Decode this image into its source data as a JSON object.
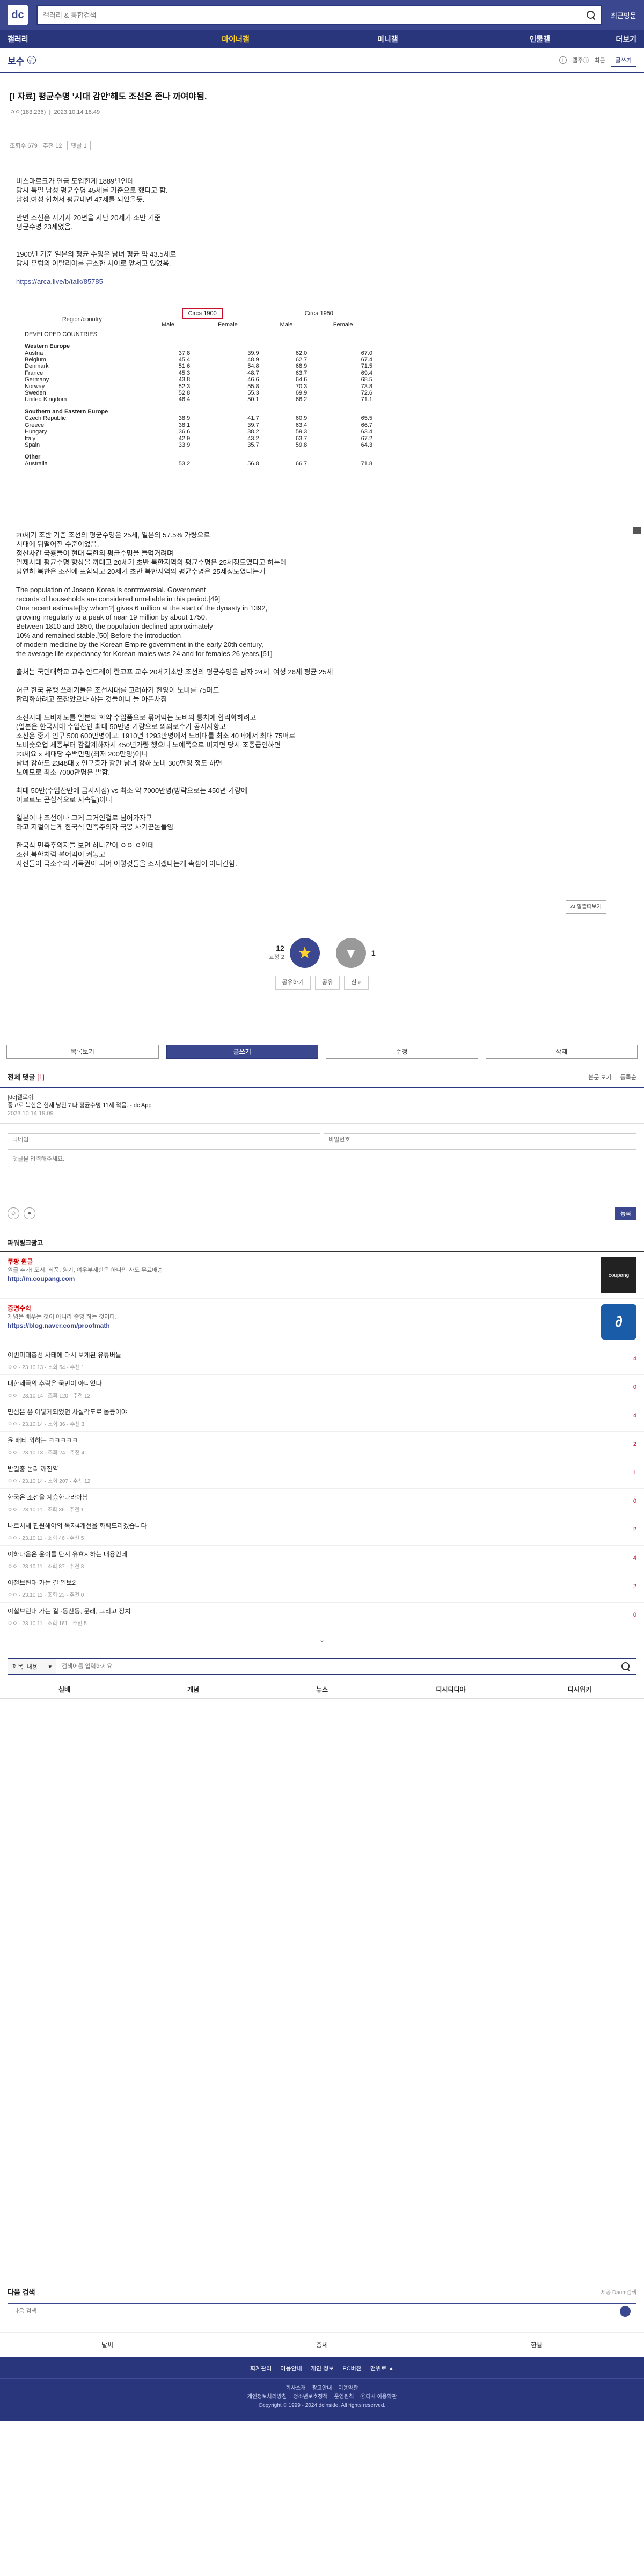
{
  "header": {
    "logo": "dc",
    "search_placeholder": "갤러리 & 통합검색",
    "recent": "최근방문",
    "nav": [
      "갤러리",
      "마이너갤",
      "미니갤",
      "인물갤",
      "더보기"
    ]
  },
  "gallery": {
    "title": "보수",
    "badge": "ⓜ",
    "info_label": "갤주ⓘ",
    "recent_btn": "최근",
    "write_btn": "글쓰기"
  },
  "post": {
    "title": "[I 자료] 평균수명 '시대 감안'해도 조선은 존나 까여야됨.",
    "author": "ㅇㅇ(183.236)",
    "date": "2023.10.14 18:49",
    "views": "조회수 679",
    "recommends": "추천 12",
    "tag": "댓글 1",
    "paragraph1": "비스마르크가 연금 도입한게 1889년인데\n당시 독일 남성 평균수명 45세를 기준으로 했다고 함.\n남성,여성 합쳐서 평균내면 47세를 되었을듯.",
    "paragraph2": "반면 조선은 지기사 20년을 지난 20세기 조반 기준\n평균수명 23세였음.",
    "paragraph3": "1900년 기준 일본의 평균 수명은 남녀 평균 약 43.5세로\n당시 유럽의 이탈리아를 근소한 차이로 앞서고 있었음.",
    "link": "https://arca.live/b/talk/85785",
    "paragraph4": "20세기 조반 기준 조선의 평균수명은 25세, 일본의 57.5% 가량으로\n시대에 뒤떨어진 수준이었음.\n정산사간 국룡들이 현대 북한의 평균수명을 들먹거려며\n일제시대 평균수명 향상을 까대고 20세기 초반 북한지역의 평균수명은 25세정도였다고 하는데\n당연히 북한은 조선에 포함되고 20세기 초반 북한지역의 평균수명은 25세정도였다는거",
    "paragraph5": "The population of Joseon Korea is controversial. Government\nrecords of households are considered unreliable in this period.[49]\nOne recent estimate[by whom?] gives 6 million at the start of the dynasty in 1392,\ngrowing irregularly to a peak of near 19 million by about 1750.\nBetween 1810 and 1850, the population declined approximately\n10% and remained stable.[50] Before the introduction\nof modern medicine by the Korean Empire government in the early 20th century,\nthe average life expectancy for Korean males was 24 and for females 26 years.[51]",
    "paragraph6": "출처는 국민대학교 교수 안드레이 란코프 교수 20세기초반 조선의 평균수명은 남자 24세, 여성 26세 평균 25세",
    "paragraph7": "허근 한국 유행 쓰레기들은 조선시대를 고려하기 한양이 노비를 75퍼드\n합리화하려고 쪼잡았으나 하는 것들이니 늘 아픈사짐",
    "paragraph8": "조선시대 노비제도를 일본의 화약 수입품으로 묶어먹는 노비의 통치에 합리화하려고\n(일본은 한국사대 수입산인 최대 50만명 가량으로 의외로수가 공지사항고\n조선은 중기 인구 500 600만명이고, 1910년 1293만명에서 노비대를 최소 40퍼에서 최대 75퍼로\n노비숫오업 세종부터 감갈계하자서 450년가량 했으니 노예쪽으로 비지면 당시 조종급인하면\n23세요 x 세대당 수백만명(최저 200만명)이니\n남녀 감하도 2348대 x 인구층가 감만 남녀 감하 노비 300만명 정도 하면\n노예모로 최소 7000만명은 발함.",
    "paragraph9": "최대 50만(수입산만에 금지사짐) vs 최소 약 7000만명(방략으로는 450년 가량에\n이르르도 곤심적으로 지속될)이니",
    "paragraph10": "일본이나 조선이나 그게 그거인걸로 넘어가자구\n라고 지껄이는게 한국식 민족주의자 국뽕 사기꾼논들임",
    "paragraph11": "한국식 민족주의자들 보면 하나같이 ㅇㅇ ㅇ인데\n조선,북한처럼 붙어먹이 켜놓고\n자신들이 극소수의 기득권이 되어 이렇것들을 조지겠다는게 속셈이 아니긴함.",
    "ai_btn": "AI 알뜰떠보기",
    "rec_up": "12",
    "rec_up_sub": "고정 2",
    "rec_down": "1",
    "tools": [
      "공유하기",
      "공유",
      "신고"
    ]
  },
  "life_table": {
    "col_region": "Region/country",
    "col_1900": "Circa 1900",
    "col_1950": "Circa 1950",
    "col_male": "Male",
    "col_female": "Female",
    "section": "DEVELOPED COUNTRIES",
    "groups": [
      {
        "name": "Western Europe",
        "rows": [
          [
            "Austria",
            "37.8",
            "39.9",
            "62.0",
            "67.0"
          ],
          [
            "Belgium",
            "45.4",
            "48.9",
            "62.7",
            "67.4"
          ],
          [
            "Denmark",
            "51.6",
            "54.8",
            "68.9",
            "71.5"
          ],
          [
            "France",
            "45.3",
            "48.7",
            "63.7",
            "69.4"
          ],
          [
            "Germany",
            "43.8",
            "46.6",
            "64.6",
            "68.5"
          ],
          [
            "Norway",
            "52.3",
            "55.8",
            "70.3",
            "73.8"
          ],
          [
            "Sweden",
            "52.8",
            "55.3",
            "69.9",
            "72.6"
          ],
          [
            "United Kingdom",
            "46.4",
            "50.1",
            "66.2",
            "71.1"
          ]
        ]
      },
      {
        "name": "Southern and Eastern Europe",
        "rows": [
          [
            "Czech Republic",
            "38.9",
            "41.7",
            "60.9",
            "65.5"
          ],
          [
            "Greece",
            "38.1",
            "39.7",
            "63.4",
            "66.7"
          ],
          [
            "Hungary",
            "36.6",
            "38.2",
            "59.3",
            "63.4"
          ],
          [
            "Italy",
            "42.9",
            "43.2",
            "63.7",
            "67.2"
          ],
          [
            "Spain",
            "33.9",
            "35.7",
            "59.8",
            "64.3"
          ]
        ]
      },
      {
        "name": "Other",
        "rows": [
          [
            "Australia",
            "53.2",
            "56.8",
            "66.7",
            "71.8"
          ]
        ]
      }
    ]
  },
  "action_buttons": [
    "목록보기",
    "글쓰기",
    "수정",
    "삭제"
  ],
  "comments": {
    "title": "전체 댓글",
    "count": "[1]",
    "sort": "본문 보기",
    "register": "등록순",
    "items": [
      {
        "nick": "[dc]갤로쉬",
        "text": "중고로 북한은 현재 낭만보다 평균수명 11세 적음. - dc App",
        "date": "2023.10.14 19:09"
      }
    ],
    "nick_placeholder": "닉네임",
    "pw_placeholder": "비밀번호",
    "content_placeholder": "댓글을 입력해주세요.",
    "submit": "등록"
  },
  "ads": {
    "title": "파워링크광고",
    "items": [
      {
        "name": "쿠팡 원글",
        "desc": "원글 추가! 도서, 식품, 원기, 여우부제한은 하나만 사도 무료배송",
        "url": "http://m.coupang.com",
        "thumb": "coupang"
      },
      {
        "name": "증명수학",
        "desc": "개념은 배우는 것이 아니라 증명 하는 것이다.",
        "url": "https://blog.naver.com/proofmath",
        "thumb": "∂"
      }
    ]
  },
  "related": [
    {
      "title": "이번미대총선 사태에 다시 보게된 유튜버들",
      "meta": "ㅇㅇ · 23.10.13 · 조회 54 · 추천 1",
      "c": "4"
    },
    {
      "title": "대한제국의 추락은 국민이 아니었다",
      "meta": "ㅇㅇ · 23.10.14 · 조회 120 · 추천 12",
      "c": "0"
    },
    {
      "title": "민심은 윤 어떻게되었던 사실각도로 몸등이야",
      "meta": "ㅇㅇ · 23.10.14 · 조회 36 · 추천 3",
      "c": "4"
    },
    {
      "title": "윤 배티 외하는 ㅋㅋㅋㅋㅋ",
      "meta": "ㅇㅇ · 23.10.13 · 조회 24 · 추천 4",
      "c": "2"
    },
    {
      "title": "반일충 논리 깨진약",
      "meta": "ㅇㅇ · 23.10.14 · 조회 207 · 추천 12",
      "c": "1"
    },
    {
      "title": "한국은 조선을 계승한나라아님",
      "meta": "ㅇㅇ · 23.10.11 · 조회 36 · 추천 1",
      "c": "0"
    },
    {
      "title": "나르치체 진원해야의 독자4개선을 화력드리겠습니다",
      "meta": "ㅇㅇ · 23.10.11 · 조회 46 · 추천 5",
      "c": "2"
    },
    {
      "title": "이하다음은 윤이를 탄시 유효시하는 내용인데",
      "meta": "ㅇㅇ · 23.10.11 · 조회 87 · 추천 3",
      "c": "4"
    },
    {
      "title": "이철브린대 가는 길 일보2",
      "meta": "ㅇㅇ · 23.10.11 · 조회 23 · 추천 0",
      "c": "2"
    },
    {
      "title": "이철브린대 가는 길 -동산동, 문래, 그리고 정치",
      "meta": "ㅇㅇ · 23.10.11 · 조회 161 · 추천 5",
      "c": "0"
    }
  ],
  "bottom_search": {
    "select": "제목+내용",
    "placeholder": "검색어를 입력하세요",
    "cats": [
      "실베",
      "개념",
      "뉴스",
      "디시티디아",
      "디시위키"
    ]
  },
  "footer": {
    "search_title": "다음 검색",
    "search_sub": "제공 Daum검색",
    "search_placeholder": "다음 검색",
    "tabs": [
      "날씨",
      "증세",
      "한율"
    ],
    "links": [
      "회계관리",
      "이용안내",
      "개인 정보",
      "PC버전",
      "맨위로 ▲"
    ],
    "row1": [
      "회사소개",
      "광고안내",
      "이용약관"
    ],
    "row2": [
      "개인정보처리방침",
      "청소년보호정책",
      "운영원칙",
      "ⓒ디시 이용약관"
    ],
    "copyright": "Copyright © 1999 - 2024 dcinside. All rights reserved."
  }
}
